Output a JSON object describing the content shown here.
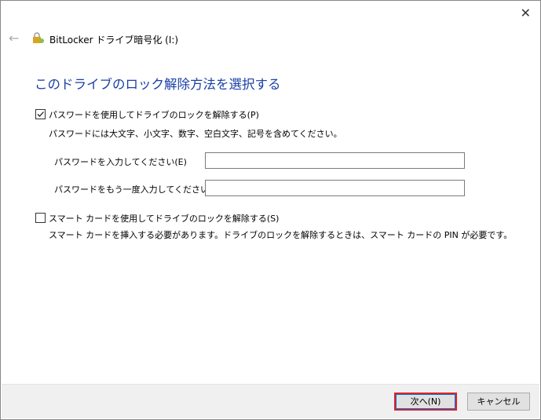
{
  "window": {
    "title": "BitLocker ドライブ暗号化 (I:)",
    "close_glyph": "✕",
    "back_glyph": "←"
  },
  "heading": "このドライブのロック解除方法を選択する",
  "password_option": {
    "checked": true,
    "label": "パスワードを使用してドライブのロックを解除する(P)",
    "hint": "パスワードには大文字、小文字、数字、空白文字、記号を含めてください。",
    "enter_label": "パスワードを入力してください(E)",
    "enter_value": "",
    "reenter_label": "パスワードをもう一度入力してください(R)",
    "reenter_value": ""
  },
  "smartcard_option": {
    "checked": false,
    "label": "スマート カードを使用してドライブのロックを解除する(S)",
    "hint": "スマート カードを挿入する必要があります。ドライブのロックを解除するときは、スマート カードの PIN が必要です。"
  },
  "buttons": {
    "next": "次へ(N)",
    "cancel": "キャンセル"
  }
}
